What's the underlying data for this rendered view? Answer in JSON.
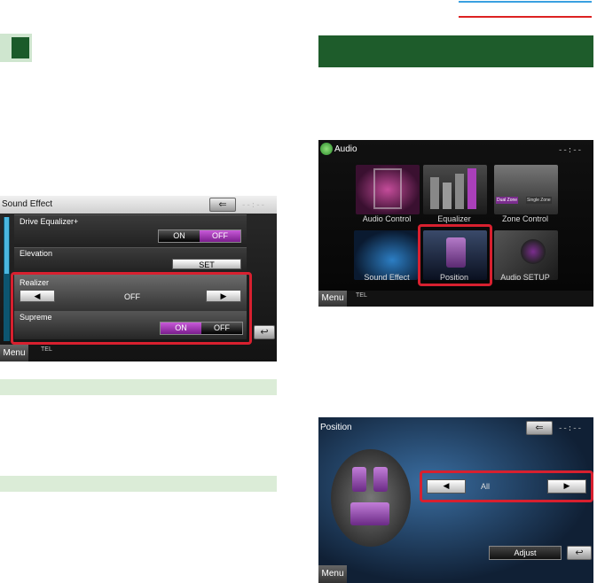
{
  "decor": {
    "green_marker": "#1b5b2a",
    "heading_bar": "#1e5c2b",
    "highlight_red": "#d8202f"
  },
  "sound_effect": {
    "title": "Sound Effect",
    "time": "--:--",
    "rows": {
      "drive_eq": "Drive Equalizer+",
      "elevation": "Elevation",
      "realizer": "Realizer",
      "supreme": "Supreme"
    },
    "on": "ON",
    "off": "OFF",
    "set": "SET",
    "realizer_value": "OFF",
    "left_arrow": "◀",
    "right_arrow": "▶",
    "menu": "Menu",
    "tel": "TEL",
    "back": "⇐",
    "return": "↩"
  },
  "audio": {
    "title": "Audio",
    "time": "--:--",
    "tiles": [
      "Audio Control",
      "Equalizer",
      "Zone Control",
      "Sound Effect",
      "Position",
      "Audio SETUP"
    ],
    "zone_tabs": [
      "Dual Zone",
      "Single Zone"
    ],
    "menu": "Menu",
    "tel": "TEL"
  },
  "position": {
    "title": "Position",
    "time": "--:--",
    "value": "All",
    "left_arrow": "◀",
    "right_arrow": "▶",
    "adjust": "Adjust",
    "menu": "Menu",
    "back": "⇐",
    "return": "↩"
  }
}
